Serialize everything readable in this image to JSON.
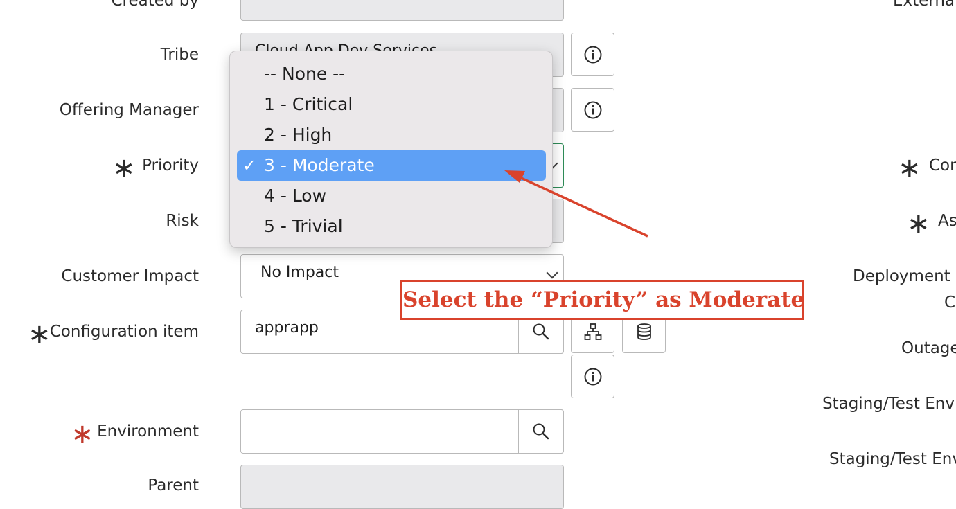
{
  "form": {
    "created_by": {
      "label": "Created by"
    },
    "tribe": {
      "label": "Tribe",
      "value": "Cloud App Dev Services"
    },
    "offering_manager": {
      "label": "Offering Manager"
    },
    "priority": {
      "label": "Priority",
      "value": "3 - Moderate"
    },
    "risk": {
      "label": "Risk"
    },
    "customer_impact": {
      "label": "Customer Impact",
      "value": "No Impact"
    },
    "configuration_item": {
      "label": "Configuration item",
      "value": "apprapp"
    },
    "environment": {
      "label": "Environment",
      "value": ""
    },
    "parent": {
      "label": "Parent"
    }
  },
  "right_column": {
    "external": "External",
    "con": "Con",
    "as": "As",
    "deployment": "Deployment R",
    "co": "Co",
    "outage": "Outage",
    "staging1": "Staging/Test Envir",
    "staging2": "Staging/Test Env"
  },
  "priority_dropdown": {
    "options": [
      {
        "label": "-- None --"
      },
      {
        "label": "1 - Critical"
      },
      {
        "label": "2 - High"
      },
      {
        "label": "3 - Moderate",
        "selected": true,
        "check": "✓"
      },
      {
        "label": "4 - Low"
      },
      {
        "label": "5 - Trivial"
      }
    ]
  },
  "annotation": {
    "text": "Select the “Priority” as Moderate",
    "color": "#d9432c"
  },
  "colors": {
    "highlight": "#5ea0f5",
    "required_red": "#c0392b"
  }
}
